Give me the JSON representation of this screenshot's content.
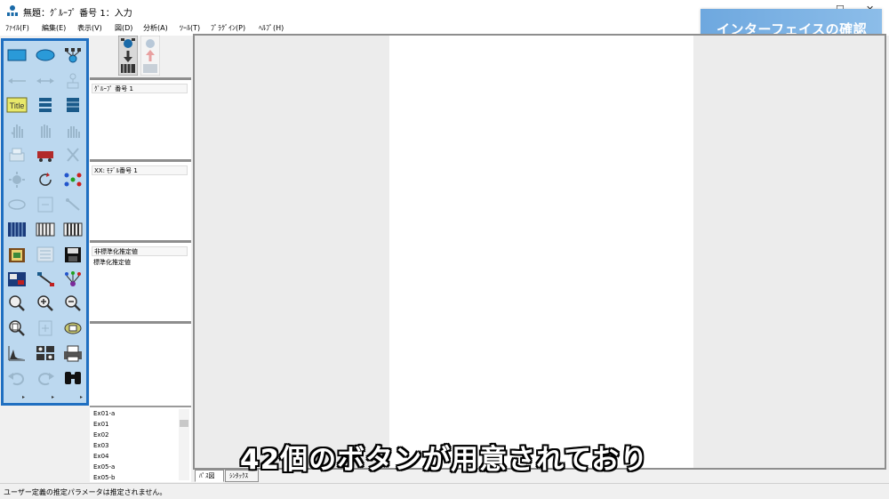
{
  "window": {
    "title": "無題：ｸﾞﾙｰﾌﾟ 番号 1：入力",
    "controls": [
      "–",
      "☐",
      "✕"
    ]
  },
  "menu": [
    {
      "label": "ﾌｧｲﾙ(F)"
    },
    {
      "label": "編集(E)"
    },
    {
      "label": "表示(V)"
    },
    {
      "label": "図(D)"
    },
    {
      "label": "分析(A)"
    },
    {
      "label": "ﾂｰﾙ(T)"
    },
    {
      "label": "ﾌﾟﾗｸﾞｲﾝ(P)"
    },
    {
      "label": "ﾍﾙﾌﾟ(H)"
    }
  ],
  "banner": {
    "text": "インターフェイスの確認"
  },
  "toolbox": {
    "title_button_label": "Title",
    "accent": "#1f6fc1",
    "background": "#bcd8ef",
    "scroll_arrows": [
      "▸",
      "▸",
      "▸"
    ]
  },
  "panels": {
    "groups": {
      "header": "ｸﾞﾙｰﾌﾟ 番号 1"
    },
    "models": {
      "header": "XX: ﾓﾃﾞﾙ番号 1"
    },
    "estimates": {
      "header": "非標準化推定値",
      "line2": "標準化推定値"
    }
  },
  "examples": [
    "Ex01-a",
    "Ex01",
    "Ex02",
    "Ex03",
    "Ex04",
    "Ex05-a",
    "Ex05-b"
  ],
  "tabs": [
    {
      "label": "ﾊﾟｽ図",
      "active": true
    },
    {
      "label": "ｼﾝﾀｯｸｽ",
      "active": false
    }
  ],
  "subtitle": "42個のボタンが用意されており",
  "status": "ユーザー定義の推定パラメータは推定されません。"
}
